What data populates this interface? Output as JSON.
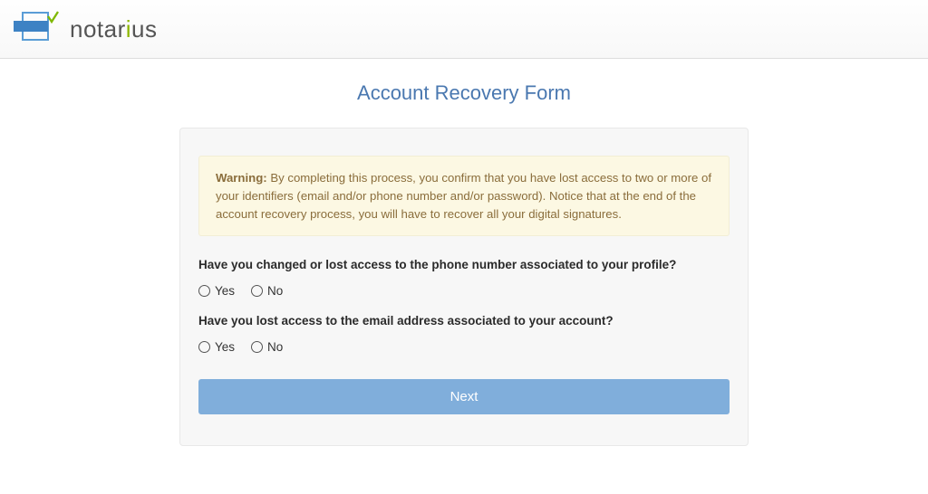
{
  "brand": {
    "name_pre": "notar",
    "name_accent": "i",
    "name_post": "us"
  },
  "page": {
    "title": "Account Recovery Form"
  },
  "alert": {
    "label": "Warning: ",
    "text": "By completing this process, you confirm that you have lost access to two or more of your identifiers (email and/or phone number and/or password). Notice that at the end of the account recovery process, you will have to recover all your digital signatures."
  },
  "questions": {
    "phone": "Have you changed or lost access to the phone number associated to your profile?",
    "email": "Have you lost access to the email address associated to your account?"
  },
  "options": {
    "yes": "Yes",
    "no": "No"
  },
  "buttons": {
    "next": "Next"
  }
}
